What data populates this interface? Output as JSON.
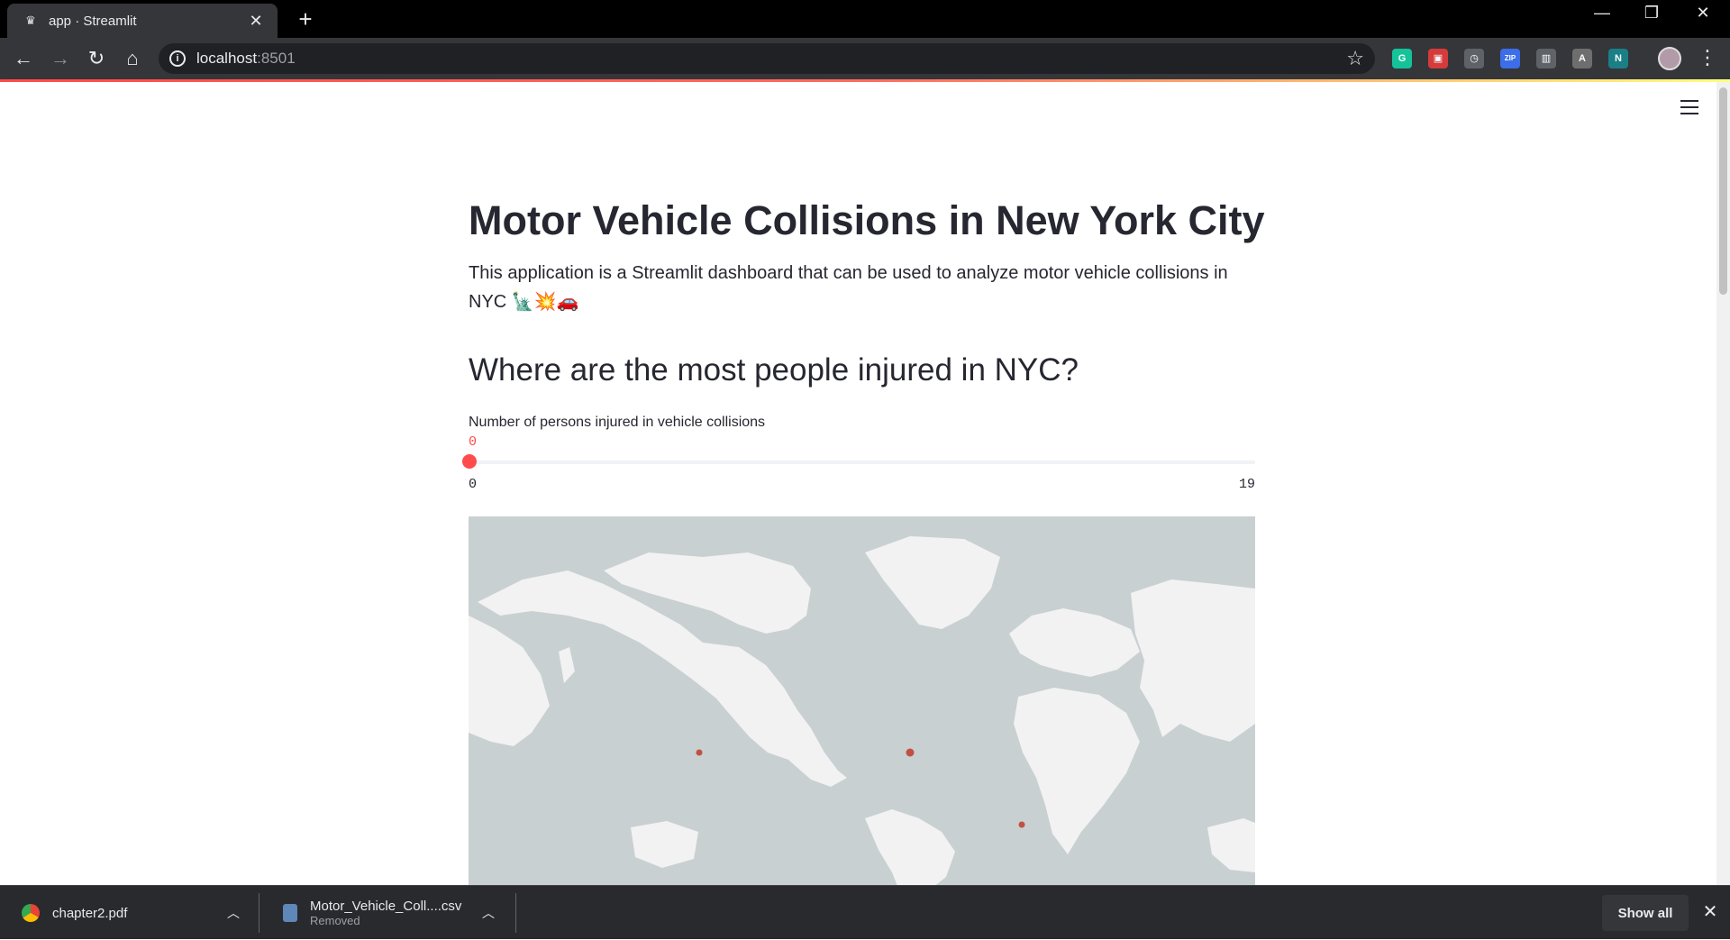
{
  "browser": {
    "tab_title": "app · Streamlit",
    "tab_close": "✕",
    "new_tab": "+",
    "url_host": "localhost",
    "url_port": ":8501",
    "window": {
      "minimize": "—",
      "restore": "❐",
      "close": "✕"
    },
    "extensions": [
      {
        "name": "grammarly-extension-icon",
        "label": "G",
        "color": "#15c39a"
      },
      {
        "name": "pdf-extension-icon",
        "label": "▣",
        "color": "#d63b3b"
      },
      {
        "name": "speed-extension-icon",
        "label": "◷",
        "color": "#5f6368"
      },
      {
        "name": "zip-extension-icon",
        "label": "ZIP",
        "color": "#3b6ee8"
      },
      {
        "name": "reader-extension-icon",
        "label": "▥",
        "color": "#5f6368"
      },
      {
        "name": "translate-extension-icon",
        "label": "A",
        "color": "#6e6e6e"
      },
      {
        "name": "notion-extension-icon",
        "label": "N",
        "color": "#1a7f86"
      }
    ]
  },
  "app": {
    "title": "Motor Vehicle Collisions in New York City",
    "intro_text": "This application is a Streamlit dashboard that can be used to analyze motor vehicle collisions in NYC",
    "intro_emojis": "🗽💥🚗",
    "section_header": "Where are the most people injured in NYC?",
    "slider": {
      "label": "Number of persons injured in vehicle collisions",
      "value": "0",
      "min": "0",
      "max": "19"
    },
    "map": {
      "ocean_color": "#c9d0d1",
      "land_color": "#f2f2f2",
      "point_color": "#c0392b"
    }
  },
  "downloads": {
    "items": [
      {
        "name": "chapter2.pdf",
        "status": ""
      },
      {
        "name": "Motor_Vehicle_Coll....csv",
        "status": "Removed"
      }
    ],
    "show_all": "Show all",
    "close": "✕"
  }
}
